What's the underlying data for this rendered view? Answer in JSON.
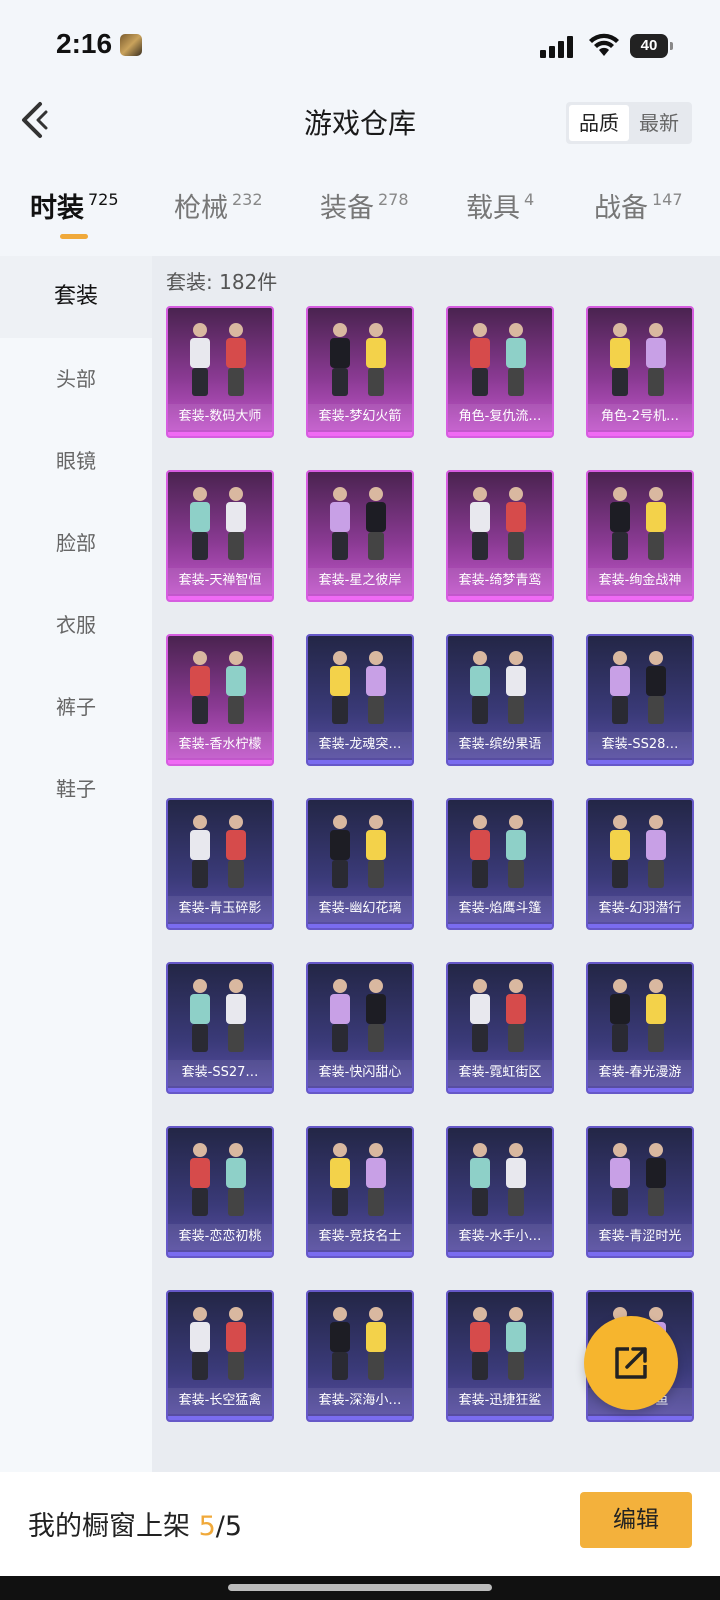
{
  "status_bar": {
    "time": "2:16",
    "battery": "40"
  },
  "header": {
    "title": "游戏仓库",
    "sort_options": [
      "品质",
      "最新"
    ]
  },
  "tabs": [
    {
      "label": "时装",
      "count": "725"
    },
    {
      "label": "枪械",
      "count": "232"
    },
    {
      "label": "装备",
      "count": "278"
    },
    {
      "label": "载具",
      "count": "4"
    },
    {
      "label": "战备",
      "count": "147"
    }
  ],
  "sidebar": [
    "套装",
    "头部",
    "眼镜",
    "脸部",
    "衣服",
    "裤子",
    "鞋子"
  ],
  "content": {
    "count_label": "套装: 182件"
  },
  "items": [
    {
      "name": "套装-数码大师",
      "rarity": "purple"
    },
    {
      "name": "套装-梦幻火箭",
      "rarity": "purple"
    },
    {
      "name": "角色-复仇流…",
      "rarity": "purple"
    },
    {
      "name": "角色-2号机…",
      "rarity": "purple"
    },
    {
      "name": "套装-天禅智恒",
      "rarity": "purple"
    },
    {
      "name": "套装-星之彼岸",
      "rarity": "purple"
    },
    {
      "name": "套装-绮梦青鸾",
      "rarity": "purple"
    },
    {
      "name": "套装-绚金战神",
      "rarity": "purple"
    },
    {
      "name": "套装-香水柠檬",
      "rarity": "purple"
    },
    {
      "name": "套装-龙魂突…",
      "rarity": "blue"
    },
    {
      "name": "套装-缤纷果语",
      "rarity": "blue"
    },
    {
      "name": "套装-SS28…",
      "rarity": "blue"
    },
    {
      "name": "套装-青玉碎影",
      "rarity": "blue"
    },
    {
      "name": "套装-幽幻花璃",
      "rarity": "blue"
    },
    {
      "name": "套装-焰鹰斗篷",
      "rarity": "blue"
    },
    {
      "name": "套装-幻羽潜行",
      "rarity": "blue"
    },
    {
      "name": "套装-SS27…",
      "rarity": "blue"
    },
    {
      "name": "套装-快闪甜心",
      "rarity": "blue"
    },
    {
      "name": "套装-霓虹街区",
      "rarity": "blue"
    },
    {
      "name": "套装-春光漫游",
      "rarity": "blue"
    },
    {
      "name": "套装-恋恋初桃",
      "rarity": "blue"
    },
    {
      "name": "套装-竞技名士",
      "rarity": "blue"
    },
    {
      "name": "套装-水手小…",
      "rarity": "blue"
    },
    {
      "name": "套装-青涩时光",
      "rarity": "blue"
    },
    {
      "name": "套装-长空猛禽",
      "rarity": "blue"
    },
    {
      "name": "套装-深海小…",
      "rarity": "blue"
    },
    {
      "name": "套装-迅捷狂鲨",
      "rarity": "blue"
    },
    {
      "name": "套装-…鱼",
      "rarity": "blue"
    }
  ],
  "bottom_bar": {
    "showcase_label": "我的橱窗上架",
    "showcase_current": "5",
    "showcase_total": "/5",
    "edit_label": "编辑"
  },
  "colors": {
    "accent": "#f0a93a",
    "purple_rarity": "#d65de0",
    "blue_rarity": "#6658c8"
  }
}
